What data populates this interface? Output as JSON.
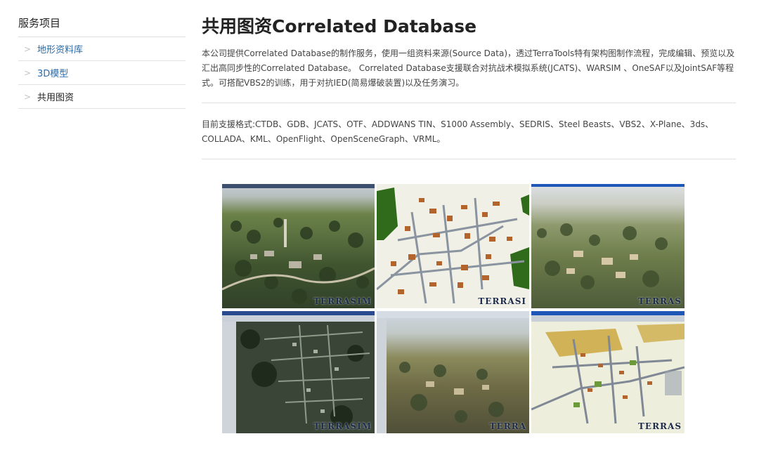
{
  "sidebar": {
    "title": "服务项目",
    "items": [
      {
        "label": "地形资料库"
      },
      {
        "label": "3D模型"
      },
      {
        "label": "共用图资"
      }
    ]
  },
  "main": {
    "title": "共用图资Correlated Database",
    "description": "本公司提供Correlated Database的制作服务，使用一组资料来源(Source Data)，透过TerraTools特有架构图制作流程，完成编辑、预览以及汇出高同步性的Correlated Database。 Correlated Database支援联合对抗战术模拟系统(JCATS)、WARSIM 、OneSAF以及JointSAF等程式。可搭配VBS2的训练，用于对抗IED(简易爆破装置)以及任务演习。",
    "formats": "目前支援格式:CTDB、GDB、JCATS、OTF、ADDWANS TIN、S1000 Assembly、SEDRIS、Steel Beasts、VBS2、X-Plane、3ds、COLLADA、KML、OpenFlight、OpenSceneGraph、VRML。"
  },
  "screenshots": {
    "watermarks": [
      "TERRASIM",
      "TERRASI",
      "TERRAS",
      "TERRASIM",
      "TERRA",
      "TERRAS"
    ]
  },
  "colors": {
    "link": "#2a6aa8",
    "divider": "#e0e0e0",
    "building": "#b3632c",
    "road": "#9aa3ad"
  }
}
